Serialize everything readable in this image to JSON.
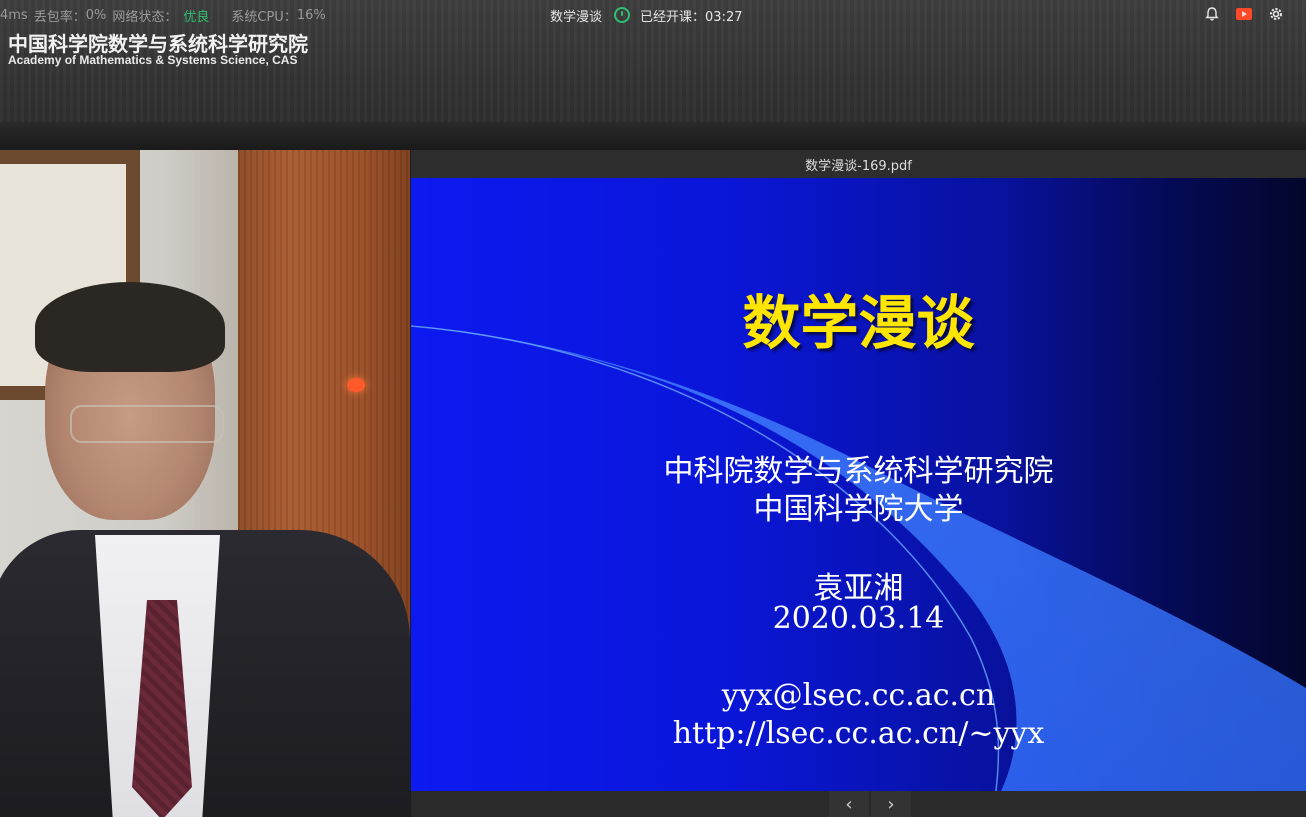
{
  "status_bar": {
    "latency": "4ms",
    "loss_label": "丢包率：",
    "loss_value": "0%",
    "network_label": "网络状态：",
    "network_value": "优良",
    "cpu_label": "系统CPU：",
    "cpu_value": "16%"
  },
  "org": {
    "name_cn": "中国科学院数学与系统科学研究院",
    "name_en": "Academy of Mathematics & Systems Science, CAS"
  },
  "session": {
    "title": "数学漫谈",
    "elapsed_label": "已经开课：",
    "elapsed_time": "03:27"
  },
  "icons": {
    "bell": "bell-icon",
    "record": "record-icon",
    "settings": "gear-icon"
  },
  "document": {
    "filename": "数学漫谈-169.pdf",
    "slide": {
      "title": "数学漫谈",
      "institution": "中科院数学与系统科学研究院",
      "university": "中国科学院大学",
      "author": "袁亚湘",
      "date": "2020.03.14",
      "email": "yyx@lsec.cc.ac.cn",
      "homepage": "http://lsec.cc.ac.cn/~yyx"
    },
    "nav": {
      "prev": "‹",
      "next": "›"
    }
  },
  "colors": {
    "accent_green": "#2fbf71",
    "slide_title": "#ffe600",
    "slide_bg": "#0c19f0"
  }
}
